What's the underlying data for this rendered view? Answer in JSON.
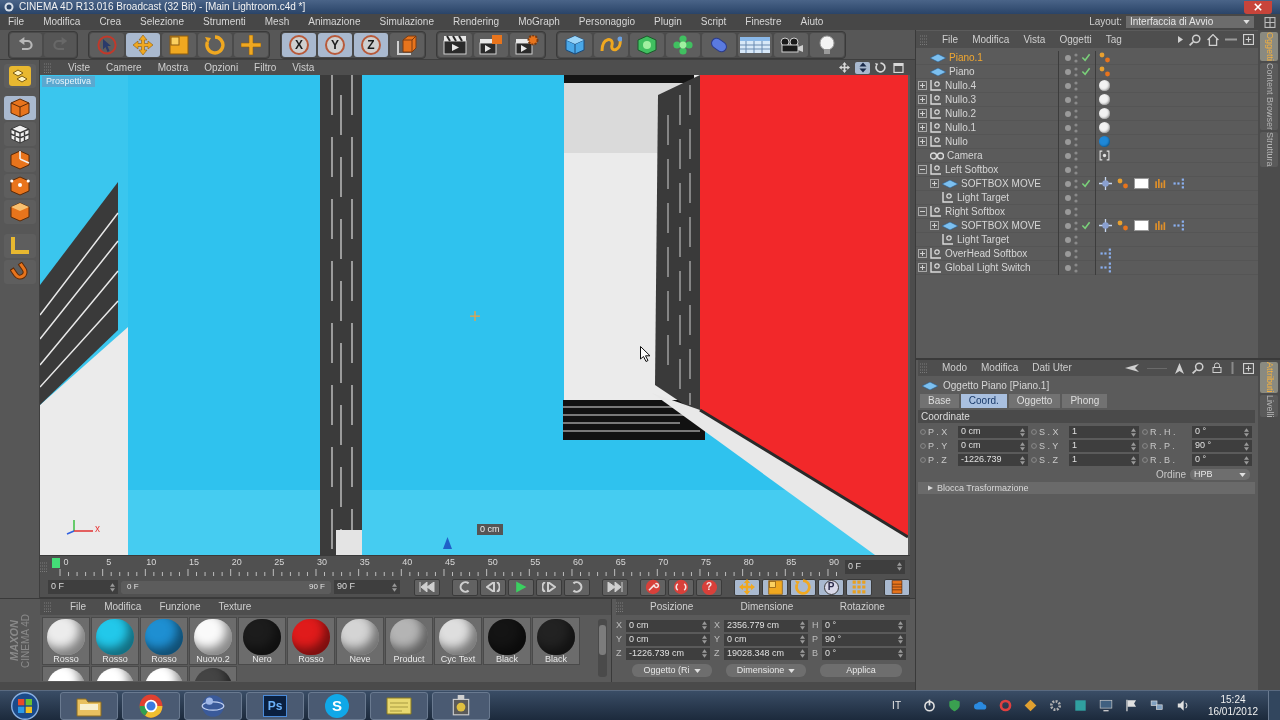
{
  "window": {
    "title": "CINEMA 4D R13.016 Broadcast (32 Bit) - [Main Lightroom.c4d *]"
  },
  "menu_bar": [
    "File",
    "Modifica",
    "Crea",
    "Selezione",
    "Strumenti",
    "Mesh",
    "Animazione",
    "Simulazione",
    "Rendering",
    "MoGraph",
    "Personaggio",
    "Plugin",
    "Script",
    "Finestre",
    "Aiuto"
  ],
  "layout": {
    "label": "Layout:",
    "value": "Interfaccia di Avvio"
  },
  "toolbar": [
    [
      {
        "kind": "undo",
        "selected": false,
        "disabled": false
      },
      {
        "kind": "redo",
        "selected": false,
        "disabled": true
      }
    ],
    [
      {
        "kind": "select",
        "selected": false
      },
      {
        "kind": "move",
        "selected": true
      },
      {
        "kind": "scale",
        "selected": false
      },
      {
        "kind": "rotate",
        "selected": false
      },
      {
        "kind": "add",
        "selected": false
      }
    ],
    [
      {
        "kind": "axis",
        "label": "X",
        "selected": true
      },
      {
        "kind": "axis",
        "label": "Y",
        "selected": true
      },
      {
        "kind": "axis",
        "label": "Z",
        "selected": true
      },
      {
        "kind": "world",
        "selected": false
      }
    ],
    [
      {
        "kind": "render-view",
        "selected": false
      },
      {
        "kind": "render",
        "selected": false
      },
      {
        "kind": "render-settings",
        "selected": false
      }
    ],
    [
      {
        "kind": "cube",
        "selected": false
      },
      {
        "kind": "spline",
        "selected": false
      },
      {
        "kind": "nurbs",
        "selected": false
      },
      {
        "kind": "array",
        "selected": false
      },
      {
        "kind": "deformer",
        "selected": false
      },
      {
        "kind": "floor",
        "selected": false
      },
      {
        "kind": "camera",
        "selected": false
      },
      {
        "kind": "light",
        "selected": false
      }
    ]
  ],
  "tool_strip": [
    {
      "kind": "make-editable",
      "selected": false
    },
    {
      "kind": "model",
      "selected": true
    },
    {
      "kind": "texture",
      "selected": false
    },
    {
      "kind": "object-axis",
      "selected": false
    },
    {
      "kind": "points",
      "selected": false
    },
    {
      "kind": "polygons",
      "selected": false
    },
    {
      "kind": "workplane",
      "selected": false
    },
    {
      "kind": "snap",
      "selected": false
    }
  ],
  "viewport": {
    "menu": [
      "Viste",
      "Camere",
      "Mostra",
      "Opzioni",
      "Filtro",
      "Vista"
    ],
    "camera": "Prospettiva",
    "readout": "0 cm",
    "axis_label": "x"
  },
  "timeline": {
    "ticks": [
      "0",
      "5",
      "10",
      "15",
      "20",
      "25",
      "30",
      "35",
      "40",
      "45",
      "50",
      "55",
      "60",
      "65",
      "70",
      "75",
      "80",
      "85",
      "90"
    ],
    "current": "0 F",
    "start_field": "0 F",
    "range": {
      "start": "0 F",
      "end": "90 F",
      "level": 1
    },
    "end_field": "90 F"
  },
  "transport": [
    [
      {
        "kind": "first",
        "selected": false
      }
    ],
    [
      {
        "kind": "prev-key",
        "selected": false
      },
      {
        "kind": "prev-frame",
        "selected": false
      },
      {
        "kind": "play",
        "selected": false
      },
      {
        "kind": "next-frame",
        "selected": false
      },
      {
        "kind": "next-key",
        "selected": false
      }
    ],
    [
      {
        "kind": "last",
        "selected": false
      }
    ],
    [
      {
        "kind": "record",
        "selected": false
      },
      {
        "kind": "autokey",
        "selected": false
      },
      {
        "kind": "keyframe-selection",
        "label": "?",
        "selected": false
      }
    ],
    [
      {
        "kind": "move",
        "selected": true
      },
      {
        "kind": "scale",
        "selected": true
      },
      {
        "kind": "rotate",
        "selected": true
      },
      {
        "kind": "parameter",
        "label": "P",
        "selected": true
      },
      {
        "kind": "point-level",
        "selected": true
      }
    ],
    [
      {
        "kind": "timeline",
        "selected": true
      }
    ]
  ],
  "logo": [
    "MAXON",
    "CINEMA 4D"
  ],
  "material_manager": {
    "menu": [
      "File",
      "Modifica",
      "Funzione",
      "Texture"
    ],
    "materials": [
      {
        "name": "Rosso",
        "color": "#ececec"
      },
      {
        "name": "Rosso",
        "color": "#22c8ea"
      },
      {
        "name": "Rosso",
        "color": "#1e8fd2"
      },
      {
        "name": "Nuovo.2",
        "color": "#fafafa"
      },
      {
        "name": "Nero",
        "color": "#1c1c1c"
      },
      {
        "name": "Rosso",
        "color": "#e01b1b"
      },
      {
        "name": "Neve",
        "color": "#d4d4d4"
      },
      {
        "name": "Product",
        "color": "#b4b4b4"
      },
      {
        "name": "Cyc Text",
        "color": "#dedede"
      },
      {
        "name": "Black",
        "color": "#141414"
      },
      {
        "name": "Black",
        "color": "#222222"
      },
      {
        "color": "#ffffff"
      },
      {
        "color": "#ffffff"
      },
      {
        "color": "#ffffff"
      },
      {
        "color": "#444444"
      }
    ]
  },
  "coordinates": {
    "headers": [
      "Posizione",
      "Dimensione",
      "Rotazione"
    ],
    "rows": [
      [
        {
          "axis": "X",
          "value": "0 cm"
        },
        {
          "axis": "X",
          "value": "2356.779 cm"
        },
        {
          "axis": "H",
          "value": "0 °"
        }
      ],
      [
        {
          "axis": "Y",
          "value": "0 cm"
        },
        {
          "axis": "Y",
          "value": "0 cm"
        },
        {
          "axis": "P",
          "value": "90 °"
        }
      ],
      [
        {
          "axis": "Z",
          "value": "-1226.739 cm"
        },
        {
          "axis": "Z",
          "value": "19028.348 cm"
        },
        {
          "axis": "B",
          "value": "0 °"
        }
      ]
    ],
    "dropdowns": [
      "Oggetto (Ri",
      "Dimensione"
    ],
    "apply": "Applica"
  },
  "object_manager": {
    "menu": [
      "File",
      "Modifica",
      "Vista",
      "Oggetti",
      "Tag"
    ],
    "objects": [
      {
        "name": "Piano.1",
        "kind": "plane",
        "selected": true,
        "check": true,
        "tags": [
          {
            "kind": "phong"
          }
        ]
      },
      {
        "name": "Piano",
        "kind": "plane",
        "selected": false,
        "check": true,
        "tags": [
          {
            "kind": "phong"
          }
        ]
      },
      {
        "name": "Nullo.4",
        "kind": "null",
        "expanded": false,
        "selected": false,
        "check": false,
        "tags": [
          {
            "kind": "material",
            "color": "#f2f2f2"
          }
        ]
      },
      {
        "name": "Nullo.3",
        "kind": "null",
        "expanded": false,
        "selected": false,
        "check": false,
        "tags": [
          {
            "kind": "material",
            "color": "#f2f2f2"
          }
        ]
      },
      {
        "name": "Nullo.2",
        "kind": "null",
        "expanded": false,
        "selected": false,
        "check": false,
        "tags": [
          {
            "kind": "material",
            "color": "#f2f2f2"
          }
        ]
      },
      {
        "name": "Nullo.1",
        "kind": "null",
        "expanded": false,
        "selected": false,
        "check": false,
        "tags": [
          {
            "kind": "material",
            "color": "#f2f2f2"
          }
        ]
      },
      {
        "name": "Nullo",
        "kind": "null",
        "expanded": false,
        "selected": false,
        "check": false,
        "tags": [
          {
            "kind": "material",
            "color": "#1e88d8"
          }
        ]
      },
      {
        "name": "Camera",
        "kind": "camera",
        "selected": false,
        "check": false,
        "tags": [
          {
            "kind": "protection"
          }
        ]
      },
      {
        "name": "Left Softbox",
        "kind": "null",
        "expanded": true,
        "selected": false,
        "check": false,
        "children": [
          {
            "name": "SOFTBOX MOVE",
            "kind": "plane",
            "expanded": false,
            "selected": false,
            "check": true,
            "tags": [
              {
                "kind": "target"
              },
              {
                "kind": "phong"
              },
              {
                "kind": "swatch",
                "color": "#ffffff"
              },
              {
                "kind": "display"
              },
              {
                "kind": "xpresso"
              }
            ]
          },
          {
            "name": "Light Target",
            "kind": "null",
            "selected": false,
            "check": false
          }
        ]
      },
      {
        "name": "Right Softbox",
        "kind": "null",
        "expanded": true,
        "selected": false,
        "check": false,
        "children": [
          {
            "name": "SOFTBOX MOVE",
            "kind": "plane",
            "expanded": false,
            "selected": false,
            "check": true,
            "tags": [
              {
                "kind": "target"
              },
              {
                "kind": "phong"
              },
              {
                "kind": "swatch",
                "color": "#ffffff"
              },
              {
                "kind": "display"
              },
              {
                "kind": "xpresso"
              }
            ]
          },
          {
            "name": "Light Target",
            "kind": "null",
            "selected": false,
            "check": false
          }
        ]
      },
      {
        "name": "OverHead Softbox",
        "kind": "null",
        "expanded": false,
        "selected": false,
        "check": false,
        "tags": [
          {
            "kind": "xpresso"
          }
        ]
      },
      {
        "name": "Global Light Switch",
        "kind": "null",
        "expanded": false,
        "selected": false,
        "check": false,
        "tags": [
          {
            "kind": "xpresso"
          }
        ]
      }
    ]
  },
  "side_tabs_top": [
    {
      "label": "Oggetti",
      "selected": true
    },
    {
      "label": "Content Browser",
      "selected": false
    },
    {
      "label": "Struttura",
      "selected": false
    }
  ],
  "attributes": {
    "menu": [
      "Modo",
      "Modifica",
      "Dati Uter"
    ],
    "title": "Oggetto Piano [Piano.1]",
    "tabs": [
      {
        "label": "Base",
        "selected": false
      },
      {
        "label": "Coord.",
        "selected": true
      },
      {
        "label": "Oggetto",
        "selected": false
      },
      {
        "label": "Phong",
        "selected": false
      }
    ],
    "section": "Coordinate",
    "fields": [
      [
        {
          "label": "P . X",
          "value": "0 cm"
        },
        {
          "label": "S . X",
          "value": "1"
        },
        {
          "label": "R . H .",
          "value": "0 °"
        }
      ],
      [
        {
          "label": "P . Y",
          "value": "0 cm"
        },
        {
          "label": "S . Y",
          "value": "1"
        },
        {
          "label": "R . P .",
          "value": "90 °"
        }
      ],
      [
        {
          "label": "P . Z",
          "value": "-1226.739"
        },
        {
          "label": "S . Z",
          "value": "1"
        },
        {
          "label": "R . B .",
          "value": "0 °"
        }
      ]
    ],
    "order": {
      "label": "Ordine",
      "value": "HPB"
    },
    "group": {
      "label": "Blocca Trasformazione",
      "expanded": false
    }
  },
  "side_tabs_bottom": [
    {
      "label": "Attributi",
      "selected": true
    },
    {
      "label": "Livelli",
      "selected": false
    }
  ],
  "taskbar": {
    "apps": [
      {
        "kind": "folder"
      },
      {
        "kind": "browser"
      },
      {
        "kind": "sphere"
      },
      {
        "kind": "text-tile",
        "label": "Ps"
      },
      {
        "kind": "text-badge",
        "label": "S"
      },
      {
        "kind": "notes"
      },
      {
        "kind": "gadget"
      }
    ],
    "language": "IT",
    "time": "15:24",
    "date": "16/01/2012"
  }
}
